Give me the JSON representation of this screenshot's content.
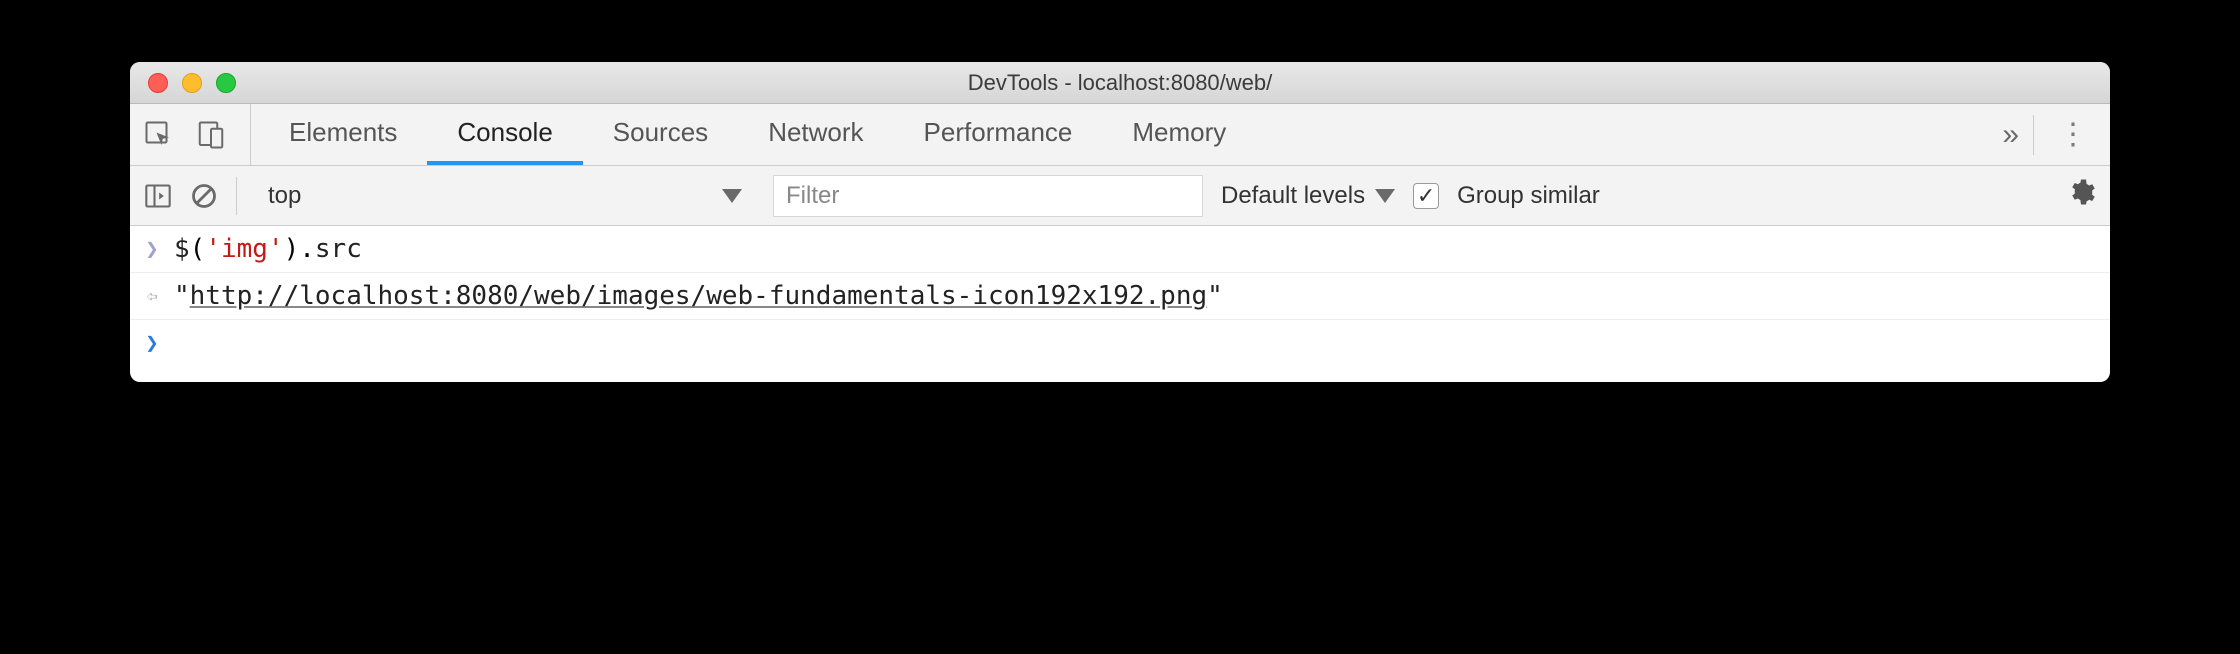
{
  "window": {
    "title": "DevTools - localhost:8080/web/"
  },
  "tabs": {
    "items": [
      {
        "label": "Elements",
        "active": false
      },
      {
        "label": "Console",
        "active": true
      },
      {
        "label": "Sources",
        "active": false
      },
      {
        "label": "Network",
        "active": false
      },
      {
        "label": "Performance",
        "active": false
      },
      {
        "label": "Memory",
        "active": false
      }
    ]
  },
  "toolbar": {
    "context": "top",
    "filter_placeholder": "Filter",
    "levels_label": "Default levels",
    "group_similar_label": "Group similar",
    "group_similar_checked": true
  },
  "console": {
    "input_code": {
      "func": "$",
      "paren_open": "(",
      "arg": "'img'",
      "paren_close": ")",
      "dot": ".",
      "prop": "src"
    },
    "output": {
      "quote": "\"",
      "url": "http://localhost:8080/web/images/web-fundamentals-icon192x192.png"
    }
  }
}
